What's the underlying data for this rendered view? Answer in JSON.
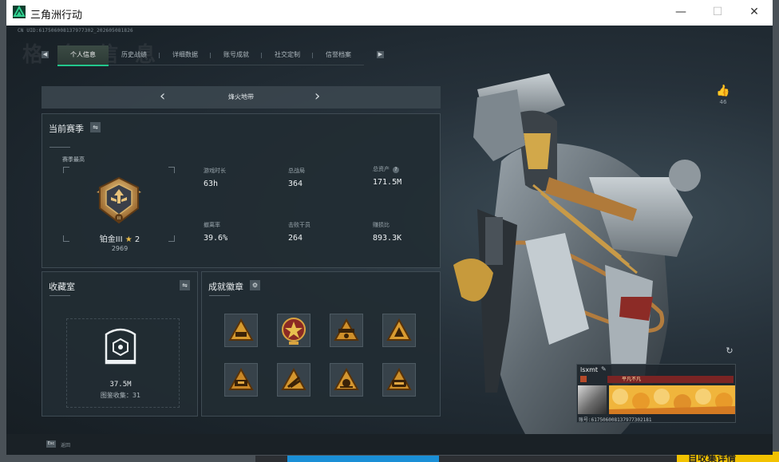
{
  "window": {
    "title": "三角洲行动",
    "min_glyph": "—",
    "max_glyph": "☐",
    "close_glyph": "✕"
  },
  "header": {
    "uid_line": "CN UID:617506008137977302_202605081826",
    "ghost_title": "格 务 信 息"
  },
  "tabs": [
    {
      "label": "个人信息",
      "active": true
    },
    {
      "label": "历史战绩",
      "active": false
    },
    {
      "label": "详细数据",
      "active": false
    },
    {
      "label": "账号成就",
      "active": false
    },
    {
      "label": "社交定制",
      "active": false
    },
    {
      "label": "信誉档案",
      "active": false
    }
  ],
  "tab_nav": {
    "prev_glyph": "◀",
    "next_glyph": "▶"
  },
  "mode": {
    "label": "烽火地带",
    "prev_glyph": "‹",
    "next_glyph": "›"
  },
  "season": {
    "title": "当前赛季",
    "switch_glyph": "⇋",
    "high_label": "赛季最高",
    "rank_name": "铂金III",
    "rank_star": "★",
    "rank_stars": "2",
    "rank_score": "2969",
    "stats": [
      {
        "label": "游戏时长",
        "value": "63h",
        "help": false
      },
      {
        "label": "总战局",
        "value": "364",
        "help": false
      },
      {
        "label": "总资产",
        "value": "171.5M",
        "help": true
      },
      {
        "label": "撤离率",
        "value": "39.6%",
        "help": false
      },
      {
        "label": "击败干员",
        "value": "264",
        "help": false
      },
      {
        "label": "赚损比",
        "value": "893.3K",
        "help": false
      }
    ],
    "help_glyph": "?"
  },
  "collection": {
    "title": "收藏室",
    "switch_glyph": "⇋",
    "value": "37.5M",
    "count_text": "图鉴收集：31"
  },
  "achievements": {
    "title": "成就徽章",
    "settings_glyph": "⚙",
    "badges": [
      "triangle-badge-1",
      "star-medal-badge",
      "triangle-badge-3",
      "triangle-badge-4",
      "triangle-badge-5",
      "triangle-badge-6",
      "triangle-badge-7",
      "triangle-badge-8"
    ]
  },
  "social": {
    "like_glyph": "👍",
    "like_count": "46",
    "refresh_glyph": "↻"
  },
  "card": {
    "name": "lsxmt",
    "edit_glyph": "✎",
    "rank_tag": "平凡不凡",
    "uid": "账号:617506008137977302181"
  },
  "footer": {
    "esc_key": "Esc",
    "back_label": "返回"
  },
  "desktop": {
    "taskbar_text": "目收集详情"
  },
  "colors": {
    "accent": "#22c78c",
    "panel": "#222c33",
    "gold": "#e6b94a"
  }
}
